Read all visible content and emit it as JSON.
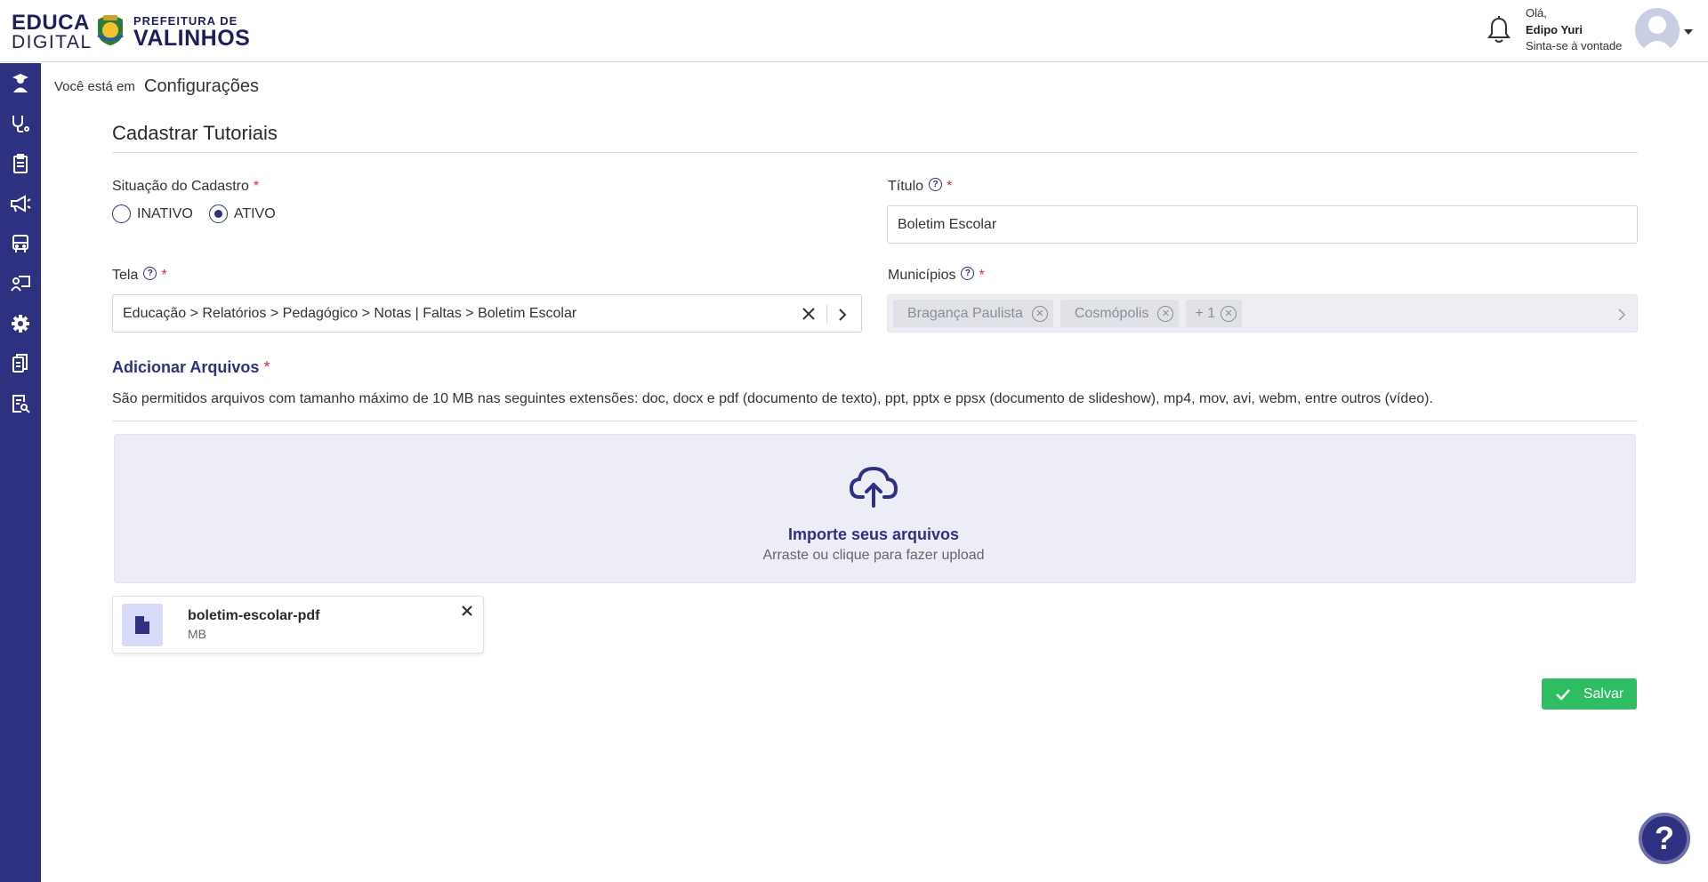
{
  "header": {
    "logo_line1": "EDUCA",
    "logo_line2": "DIGITAL",
    "pref_line1": "PREFEITURA DE",
    "pref_line2": "VALINHOS",
    "greeting": "Olá,",
    "user_name": "Edipo Yuri",
    "welcome": "Sinta-se à vontade"
  },
  "sidebar": {
    "items": [
      {
        "icon": "graduate-icon"
      },
      {
        "icon": "stethoscope-icon"
      },
      {
        "icon": "clipboard-icon"
      },
      {
        "icon": "megaphone-icon"
      },
      {
        "icon": "bus-icon"
      },
      {
        "icon": "teacher-board-icon"
      },
      {
        "icon": "gear-icon"
      },
      {
        "icon": "documents-icon"
      },
      {
        "icon": "report-search-icon"
      }
    ]
  },
  "breadcrumb": {
    "prefix": "Você está em",
    "current": "Configurações"
  },
  "form": {
    "title": "Cadastrar Tutoriais",
    "situacao_label": "Situação do Cadastro",
    "radio_inativo": "INATIVO",
    "radio_ativo": "ATIVO",
    "selected_status": "ATIVO",
    "titulo_label": "Título",
    "titulo_value": "Boletim Escolar",
    "tela_label": "Tela",
    "tela_value": "Educação > Relatórios > Pedagógico > Notas | Faltas > Boletim Escolar",
    "municipios_label": "Municípios",
    "municipios_chips": [
      "Bragança Paulista",
      "Cosmópolis",
      "+ 1"
    ],
    "required_mark": "*",
    "help_mark": "?"
  },
  "files": {
    "label": "Adicionar Arquivos",
    "hint": "São permitidos arquivos com tamanho máximo de 10 MB nas seguintes extensões: doc, docx e pdf (documento de texto), ppt, pptx e ppsx (documento de slideshow), mp4, mov, avi, webm, entre outros (vídeo).",
    "dropzone_title": "Importe seus arquivos",
    "dropzone_sub": "Arraste ou clique para fazer upload",
    "uploaded": {
      "name": "boletim-escolar-pdf",
      "size": "MB"
    }
  },
  "actions": {
    "save_label": "Salvar",
    "help_fab": "?"
  },
  "colors": {
    "primary": "#2e3080",
    "success": "#2ebd63",
    "required": "#e0293c",
    "dropzone_bg": "#ededf8"
  }
}
